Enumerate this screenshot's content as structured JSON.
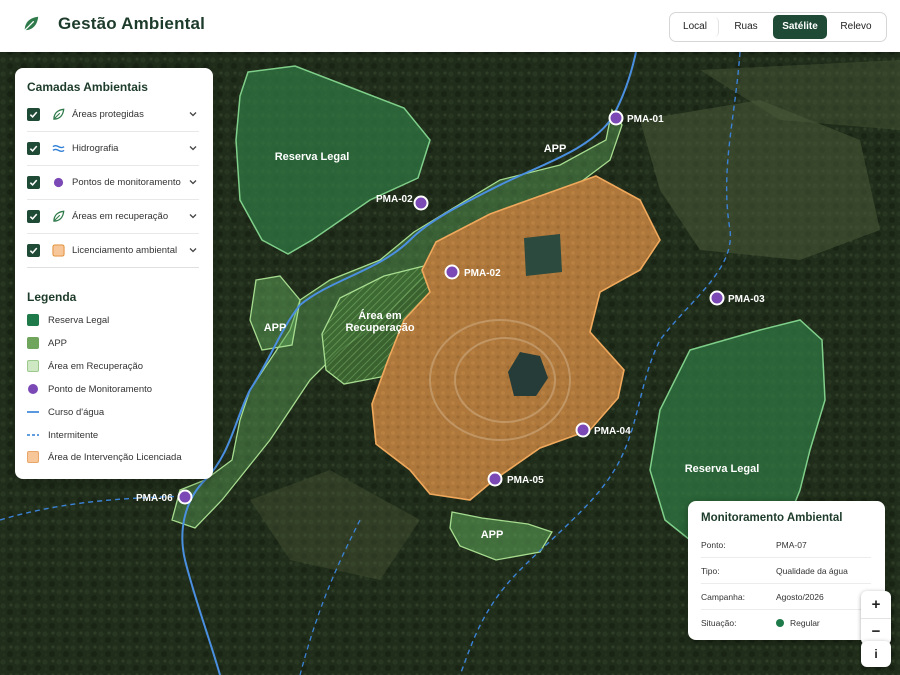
{
  "header": {
    "title": "Gestão Ambiental",
    "tabs": [
      {
        "label": "Local",
        "active": false
      },
      {
        "label": "Ruas",
        "active": false
      },
      {
        "label": "Satélite",
        "active": true
      },
      {
        "label": "Relevo",
        "active": false
      }
    ]
  },
  "layers_panel": {
    "title": "Camadas Ambientais",
    "layers": [
      {
        "label": "Áreas protegidas",
        "checked": true,
        "icon": "leaf-icon"
      },
      {
        "label": "Hidrografia",
        "checked": true,
        "icon": "waves-icon"
      },
      {
        "label": "Pontos de monitoramento",
        "checked": true,
        "icon": "dot-icon"
      },
      {
        "label": "Áreas em recuperação",
        "checked": true,
        "icon": "leaf-icon"
      },
      {
        "label": "Licenciamento ambiental",
        "checked": true,
        "icon": "square-icon"
      }
    ],
    "legend_title": "Legenda",
    "legend": [
      {
        "label": "Reserva Legal",
        "kind": "square",
        "color": "#1f7a4a"
      },
      {
        "label": "APP",
        "kind": "square",
        "color": "#6fa55c"
      },
      {
        "label": "Área em Recuperação",
        "kind": "square-light",
        "color": "#cfe8c4"
      },
      {
        "label": "Ponto de Monitoramento",
        "kind": "dot",
        "color": "#7b49b5"
      },
      {
        "label": "Curso d'água",
        "kind": "line",
        "color": "#2f7fd6"
      },
      {
        "label": "Intermitente",
        "kind": "dash",
        "color": "#2f7fd6"
      },
      {
        "label": "Área de Intervenção Licenciada",
        "kind": "square-orange",
        "color": "#f7c79a"
      }
    ]
  },
  "map": {
    "labels": {
      "reserva_legal_1": "Reserva Legal",
      "reserva_legal_2": "Reserva Legal",
      "app_1": "APP",
      "app_2": "APP",
      "app_3": "APP",
      "recuperacao_1": "Área em",
      "recuperacao_2": "Recuperação"
    },
    "points": [
      "PMA-01",
      "PMA-02",
      "PMA-02",
      "PMA-03",
      "PMA-04",
      "PMA-05",
      "PMA-06"
    ]
  },
  "info_panel": {
    "title": "Monitoramento Ambiental",
    "rows": [
      {
        "key": "Ponto:",
        "value": "PMA-07"
      },
      {
        "key": "Tipo:",
        "value": "Qualidade da água"
      },
      {
        "key": "Campanha:",
        "value": "Agosto/2026"
      },
      {
        "key": "Situação:",
        "value": "Regular"
      }
    ],
    "status_color": "#1f7a4a"
  },
  "controls": {
    "zoom_in": "+",
    "zoom_out": "−",
    "info": "i"
  },
  "colors": {
    "brand": "#1f4a36",
    "point": "#7b49b5",
    "license": "#e08a2e",
    "water": "#3b82d6"
  }
}
